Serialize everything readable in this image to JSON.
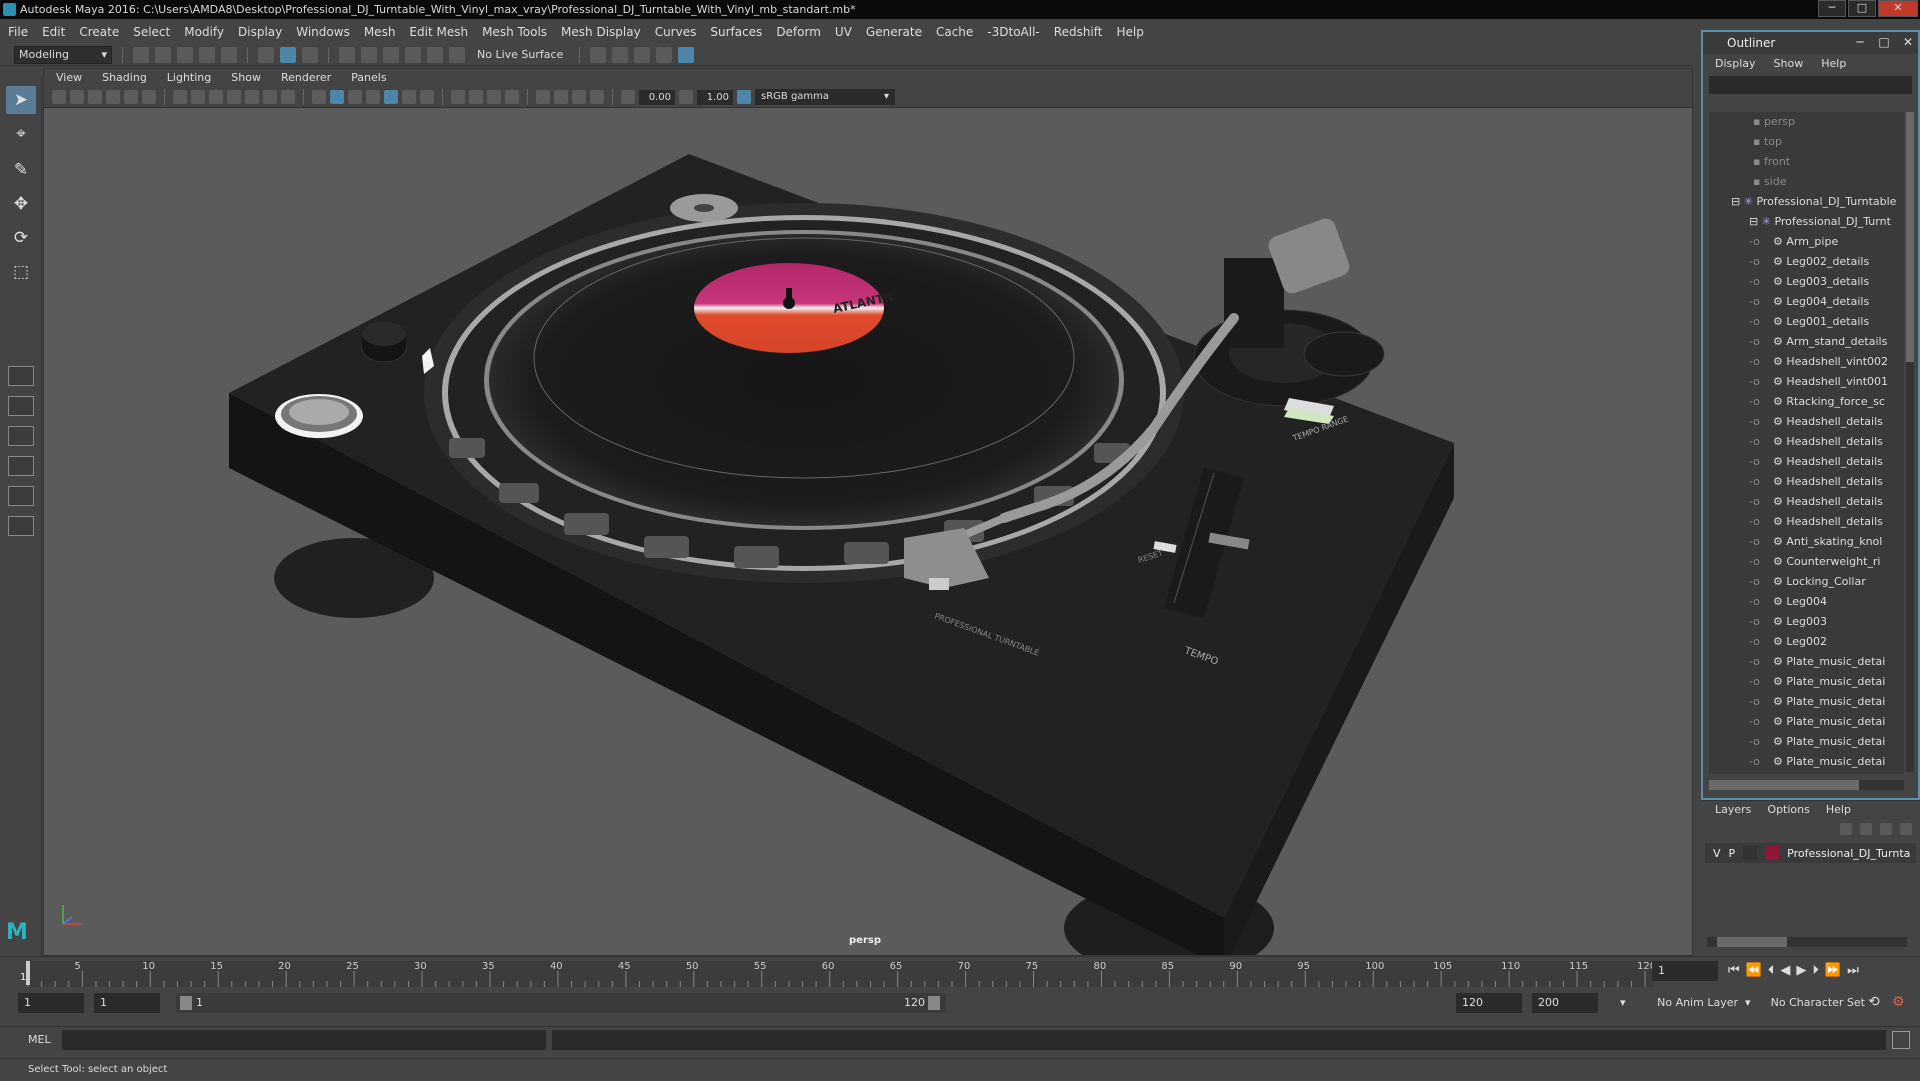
{
  "window": {
    "title": "Autodesk Maya 2016: C:\\Users\\AMDA8\\Desktop\\Professional_DJ_Turntable_With_Vinyl_max_vray\\Professional_DJ_Turntable_With_Vinyl_mb_standart.mb*",
    "min_label": "─",
    "max_label": "□",
    "close_label": "✕"
  },
  "menubar": [
    "File",
    "Edit",
    "Create",
    "Select",
    "Modify",
    "Display",
    "Windows",
    "Mesh",
    "Edit Mesh",
    "Mesh Tools",
    "Mesh Display",
    "Curves",
    "Surfaces",
    "Deform",
    "UV",
    "Generate",
    "Cache",
    "-3DtoAll-",
    "Redshift",
    "Help"
  ],
  "shelf": {
    "mode": "Modeling",
    "live_surface": "No Live Surface"
  },
  "viewport": {
    "menu": [
      "View",
      "Shading",
      "Lighting",
      "Show",
      "Renderer",
      "Panels"
    ],
    "exposure": "0.00",
    "gamma": "1.00",
    "color_space": "sRGB gamma",
    "camera": "persp",
    "scene_text": {
      "reset": "RESET",
      "tempo": "TEMPO",
      "tempo_range": "TEMPO RANGE",
      "brand": "PROFESSIONAL TURNTABLE",
      "label": "ATLANTIC"
    }
  },
  "outliner": {
    "title": "Outliner",
    "menu": [
      "Display",
      "Show",
      "Help"
    ],
    "cameras": [
      "persp",
      "top",
      "front",
      "side"
    ],
    "group": "Professional_DJ_Turntable",
    "subgroup": "Professional_DJ_Turnt",
    "items": [
      "Arm_pipe",
      "Leg002_details",
      "Leg003_details",
      "Leg004_details",
      "Leg001_details",
      "Arm_stand_details",
      "Headshell_vint002",
      "Headshell_vint001",
      "Rtacking_force_sc",
      "Headshell_details",
      "Headshell_details",
      "Headshell_details",
      "Headshell_details",
      "Headshell_details",
      "Headshell_details",
      "Anti_skating_knol",
      "Counterweight_ri",
      "Locking_Collar",
      "Leg004",
      "Leg003",
      "Leg002",
      "Plate_music_detai",
      "Plate_music_detai",
      "Plate_music_detai",
      "Plate_music_detai",
      "Plate_music_detai",
      "Plate_music_detai"
    ]
  },
  "layers": {
    "menu": [
      "Layers",
      "Options",
      "Help"
    ],
    "v": "V",
    "p": "P",
    "layer_name": "Professional_DJ_Turnta",
    "layer_color": "#8e1836"
  },
  "timeline": {
    "ticks": [
      "5",
      "10",
      "15",
      "20",
      "25",
      "30",
      "35",
      "40",
      "45",
      "50",
      "55",
      "60",
      "65",
      "70",
      "75",
      "80",
      "85",
      "90",
      "95",
      "100",
      "105",
      "110",
      "115",
      "120"
    ],
    "start_tick": "1",
    "current_frame": "1"
  },
  "range": {
    "start": "1",
    "playback_start": "1",
    "slider_start": "1",
    "slider_end": "120",
    "playback_end": "120",
    "end": "200",
    "anim_layer": "No Anim Layer",
    "character_set": "No Character Set"
  },
  "cmd": {
    "label": "MEL"
  },
  "status": {
    "text": "Select Tool: select an object"
  }
}
